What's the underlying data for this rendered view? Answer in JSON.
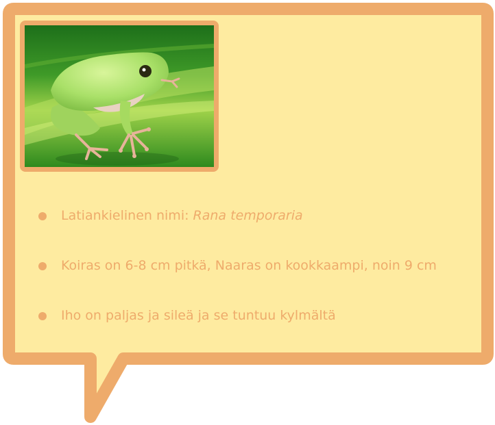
{
  "colors": {
    "border": "#eeab6b",
    "fill": "#feeba0",
    "text": "#eeab6b"
  },
  "photo": {
    "icon": "frog-icon"
  },
  "facts": [
    {
      "label": "Latiankielinen nimi: ",
      "emphasis": "Rana temporaria"
    },
    {
      "text": "Koiras on 6-8 cm pitkä, Naaras on kookkaampi, noin 9 cm"
    },
    {
      "text": "Iho on paljas ja sileä ja se tuntuu kylmältä"
    }
  ]
}
